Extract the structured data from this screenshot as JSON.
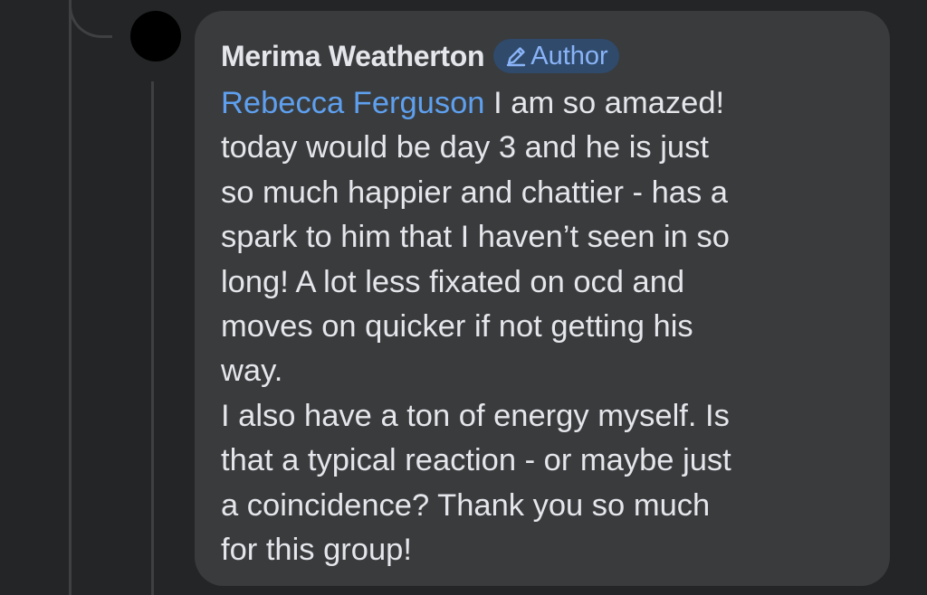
{
  "comment": {
    "author": "Merima Weatherton",
    "badge_label": "Author",
    "badge_icon": "pencil-icon",
    "mention": "Rebecca Ferguson",
    "text": " I am so amazed!\ntoday would be day 3 and he is just\nso much happier and chattier - has a\nspark to him that I haven’t seen in so\nlong! A lot less fixated on ocd and\nmoves on quicker if not getting his\nway.\nI also have a ton of energy myself. Is\nthat a typical reaction - or maybe just\na coincidence? Thank you so much\nfor this group!"
  },
  "colors": {
    "background": "#242526",
    "bubble": "#3a3b3c",
    "text": "#e4e6eb",
    "mention": "#5ea0ef",
    "badge_bg": "#2f4a6b",
    "badge_text": "#8ab4f8"
  }
}
